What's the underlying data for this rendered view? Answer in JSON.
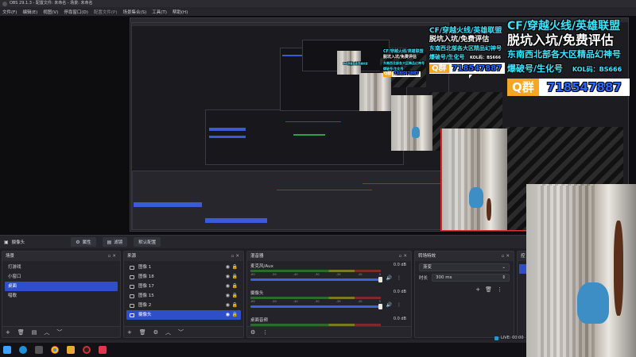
{
  "window": {
    "title": "OBS 29.1.3 - 配置文件: 未命名 - 场景: 未命名"
  },
  "menu": [
    "文件(F)",
    "编辑(E)",
    "视图(V)",
    "停靠窗口(D)",
    "配置文件(P)",
    "场景集合(S)",
    "工具(T)",
    "帮助(H)"
  ],
  "source_bar": {
    "source": "摄像头",
    "properties": "属性",
    "filters": "滤镜",
    "default": "默认配置"
  },
  "docks": {
    "scenes": {
      "title": "场景",
      "items": [
        "打游戏",
        "小窗口",
        "桌面",
        "唱歌"
      ],
      "selected": 2
    },
    "sources": {
      "title": "来源",
      "items": [
        "图像 1",
        "图像 18",
        "图像 17",
        "图像 15",
        "图像 2",
        "摄像头"
      ],
      "selected": 5
    },
    "mixer": {
      "title": "混音器",
      "channels": [
        {
          "name": "麦克风/Aux",
          "db": "0.0 dB",
          "level": 0.92
        },
        {
          "name": "摄像头",
          "db": "0.0 dB",
          "level": 0.92
        },
        {
          "name": "桌面音频",
          "db": "0.0 dB",
          "level": 0.92
        }
      ]
    },
    "transitions": {
      "title": "转场特效",
      "type": "渐变",
      "duration_label": "时长",
      "duration_value": "300 ms"
    },
    "controls_title": "控"
  },
  "promo": {
    "line1": "CF/穿越火线/英雄联盟",
    "line2": "脱坑入坑/免费评估",
    "line3": "东南西北部各大区精品幻神号",
    "line4": "爆破号/生化号",
    "kol": "KOL码：BS666",
    "q_label": "Q群",
    "q_number": "718547887"
  },
  "status": {
    "live": "LIVE: 00:00"
  },
  "colors": {
    "accent": "#2f4fc9",
    "promo_cyan": "#39e6ff",
    "promo_white": "#ffffff",
    "q_orange": "#f5a623"
  }
}
